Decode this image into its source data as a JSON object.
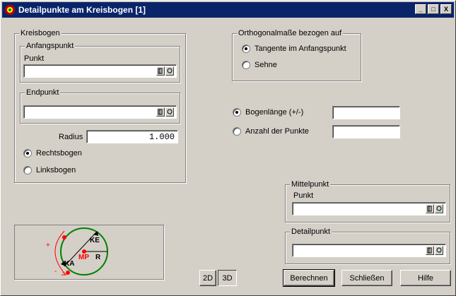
{
  "window": {
    "title": "Detailpunkte am Kreisbogen [1]",
    "controls": [
      "_",
      "□",
      "X"
    ]
  },
  "kreisbogen": {
    "group_label": "Kreisbogen",
    "anfangspunkt": {
      "group_label": "Anfangspunkt",
      "label": "Punkt",
      "value": ""
    },
    "endpunkt": {
      "group_label": "Endpunkt",
      "value": ""
    },
    "radius": {
      "label": "Radius",
      "value": "1.000"
    },
    "rechtsbogen": {
      "label": "Rechtsbogen",
      "checked": true
    },
    "linksbogen": {
      "label": "Linksbogen",
      "checked": false
    }
  },
  "orthogonal": {
    "group_label": "Orthogonalmaße bezogen auf",
    "tangente": {
      "label": "Tangente im Anfangspunkt",
      "checked": true
    },
    "sehne": {
      "label": "Sehne",
      "checked": false
    }
  },
  "bogenlaenge": {
    "label": "Bogenlänge (+/-)",
    "checked": true,
    "value": ""
  },
  "anzahl": {
    "label": "Anzahl der Punkte",
    "checked": false,
    "value": ""
  },
  "mittelpunkt": {
    "group_label": "Mittelpunkt",
    "label": "Punkt",
    "value": ""
  },
  "detailpunkt": {
    "group_label": "Detailpunkt",
    "value": ""
  },
  "diagram": {
    "labels": {
      "ke": "KE",
      "ka": "KA",
      "mp": "MP",
      "r": "R",
      "plus": "+",
      "minus": "-"
    },
    "circle_color": "#008000",
    "accent_color": "#ff0000"
  },
  "view": {
    "btn_2d": "2D",
    "btn_3d": "3D"
  },
  "buttons": {
    "berechnen": "Berechnen",
    "schliessen": "Schließen",
    "hilfe": "Hilfe"
  }
}
